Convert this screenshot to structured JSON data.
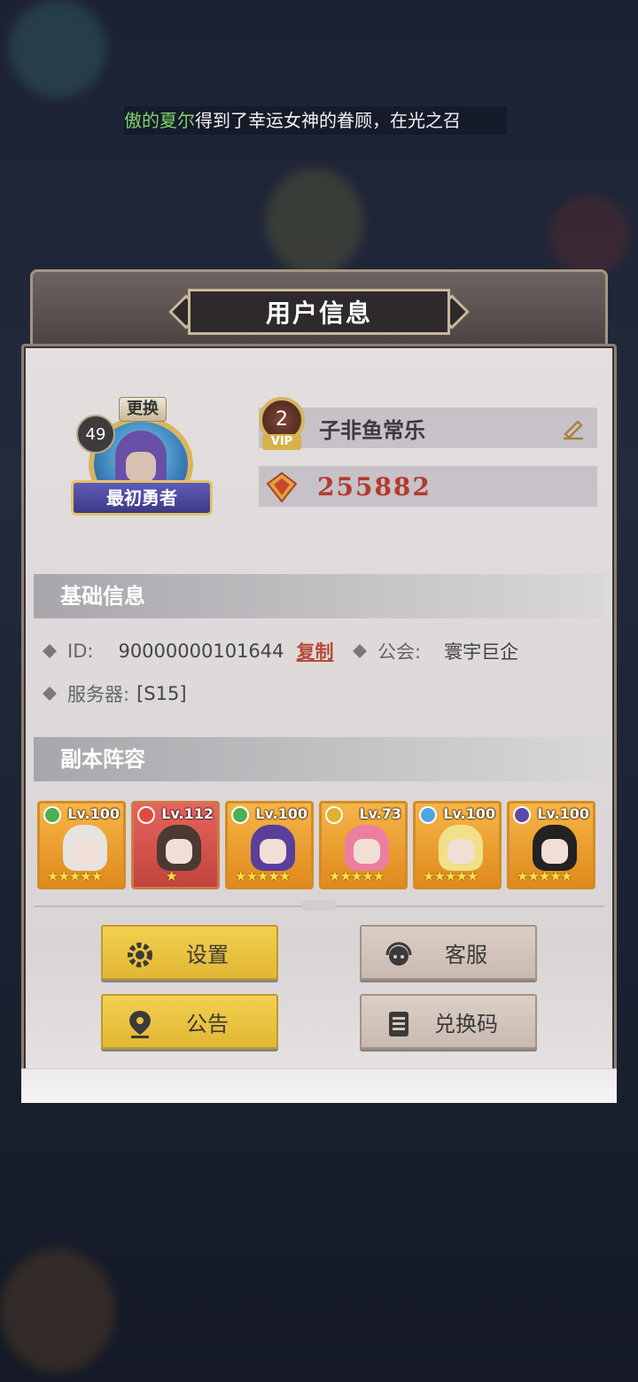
{
  "ticker": {
    "name": "傲的夏尔",
    "text": "得到了幸运女神的眷顾，在光之召"
  },
  "dialog": {
    "title": "用户信息"
  },
  "profile": {
    "level": "49",
    "change_label": "更换",
    "title_banner": "最初勇者",
    "vip_level": "2",
    "vip_label": "VIP",
    "username": "子非鱼常乐",
    "score": "255882"
  },
  "basic": {
    "header": "基础信息",
    "id_label": "ID:",
    "id_value": "90000000101644",
    "copy_label": "复制",
    "guild_label": "公会:",
    "guild_value": "寰宇巨企",
    "server_label": "服务器:",
    "server_value": "[S15]"
  },
  "team": {
    "header": "副本阵容",
    "heroes": [
      {
        "lv": "Lv.100",
        "stars": "★★★★★",
        "element_color": "#4caf50",
        "hair": "#e7e3e0"
      },
      {
        "lv": "Lv.112",
        "stars": "★",
        "element_color": "#e24b3c",
        "hair": "#4a3a33"
      },
      {
        "lv": "Lv.100",
        "stars": "★★★★★",
        "element_color": "#4caf50",
        "hair": "#5a3e9c"
      },
      {
        "lv": "Lv.73",
        "stars": "★★★★★",
        "element_color": "#e0b12a",
        "hair": "#ec7fa0"
      },
      {
        "lv": "Lv.100",
        "stars": "★★★★★",
        "element_color": "#4ea6e0",
        "hair": "#f0e08a"
      },
      {
        "lv": "Lv.100",
        "stars": "★★★★★",
        "element_color": "#5a4aa8",
        "hair": "#222222"
      }
    ]
  },
  "buttons": {
    "settings": "设置",
    "support": "客服",
    "notice": "公告",
    "redeem": "兑换码"
  }
}
